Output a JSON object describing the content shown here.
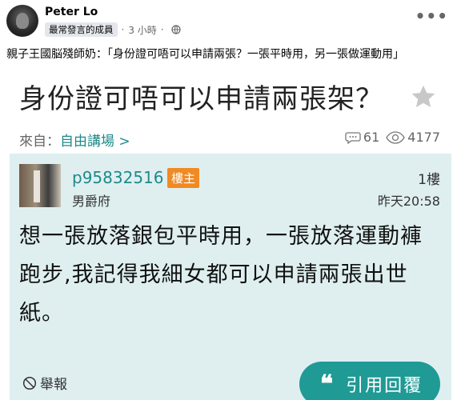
{
  "post": {
    "author": "Peter Lo",
    "badge": "最常發言的成員",
    "time": "3 小時",
    "more_icon": "more-icon",
    "caption": "親子王國脳殘師奶：「身份證可唔可以申請兩張？一張平時用，另一張做運動用」"
  },
  "forum": {
    "title": "身份證可唔可以申請兩張架？",
    "from_label": "來自：",
    "board": "自由講場 >",
    "comments": "61",
    "views": "4177",
    "username": "p95832516",
    "owner_tag": "樓主",
    "rank": "男爵府",
    "floor": "1樓",
    "time": "昨天20:58",
    "content": "想一張放落銀包平時用，一張放落運動褲跑步,我記得我細女都可以申請兩張出世紙。",
    "report": "舉報",
    "reply_quote": "❝",
    "reply": "引用回覆"
  },
  "colors": {
    "accent": "#1f9a95",
    "owner_tag": "#f08a22",
    "shot_bg": "#dfeff0"
  }
}
